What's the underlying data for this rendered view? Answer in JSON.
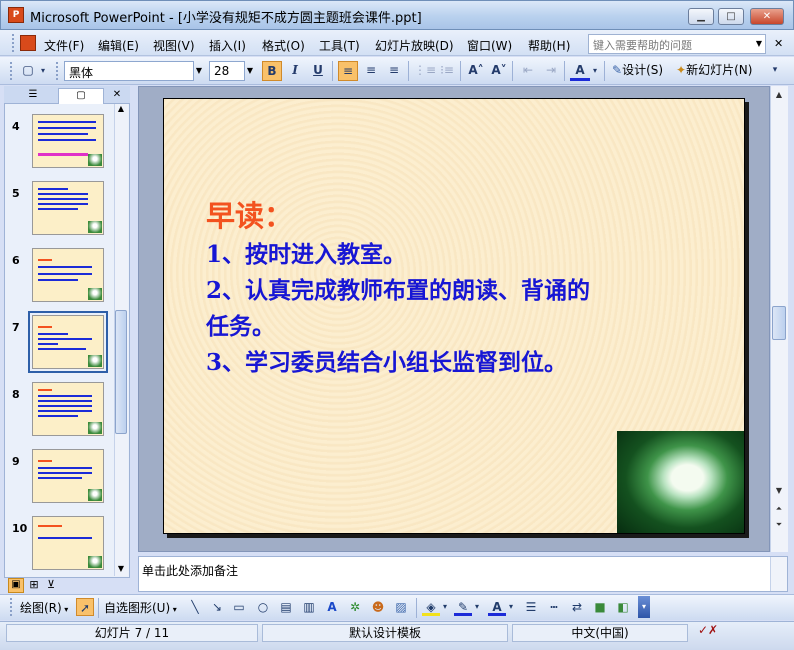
{
  "window": {
    "app_icon": "P",
    "title": "Microsoft PowerPoint - [小学没有规矩不成方圆主题班会课件.ppt]",
    "minimize": "▁",
    "maximize": "□",
    "close": "✕"
  },
  "menu": {
    "items": [
      "文件(F)",
      "编辑(E)",
      "视图(V)",
      "插入(I)",
      "格式(O)",
      "工具(T)",
      "幻灯片放映(D)",
      "窗口(W)",
      "帮助(H)"
    ],
    "help_placeholder": "键入需要帮助的问题"
  },
  "toolbar": {
    "font_name": "黑体",
    "font_size": "28",
    "bold": "B",
    "italic": "I",
    "underline": "U",
    "design_label": "设计(S)",
    "new_slide_label": "新幻灯片(N)"
  },
  "panel": {
    "tab_outline_icon": "outline-icon",
    "tab_slides_icon": "slides-icon",
    "close": "✕",
    "thumbnails": [
      {
        "number": "4"
      },
      {
        "number": "5"
      },
      {
        "number": "6"
      },
      {
        "number": "7",
        "selected": true
      },
      {
        "number": "8"
      },
      {
        "number": "9"
      },
      {
        "number": "10"
      }
    ]
  },
  "slide": {
    "heading": "早读：",
    "lines": [
      "1、按时进入教室。",
      "2、认真完成教师布置的朗读、背诵的",
      "任务。",
      "3、学习委员结合小组长监督到位。"
    ],
    "heading_color": "#f3521f",
    "body_color": "#1716d4"
  },
  "notes": {
    "placeholder": "单击此处添加备注"
  },
  "drawing_toolbar": {
    "draw_label": "绘图(R)",
    "autoshapes_label": "自选图形(U)"
  },
  "status": {
    "slide_info": "幻灯片 7 / 11",
    "template": "默认设计模板",
    "language": "中文(中国)"
  }
}
